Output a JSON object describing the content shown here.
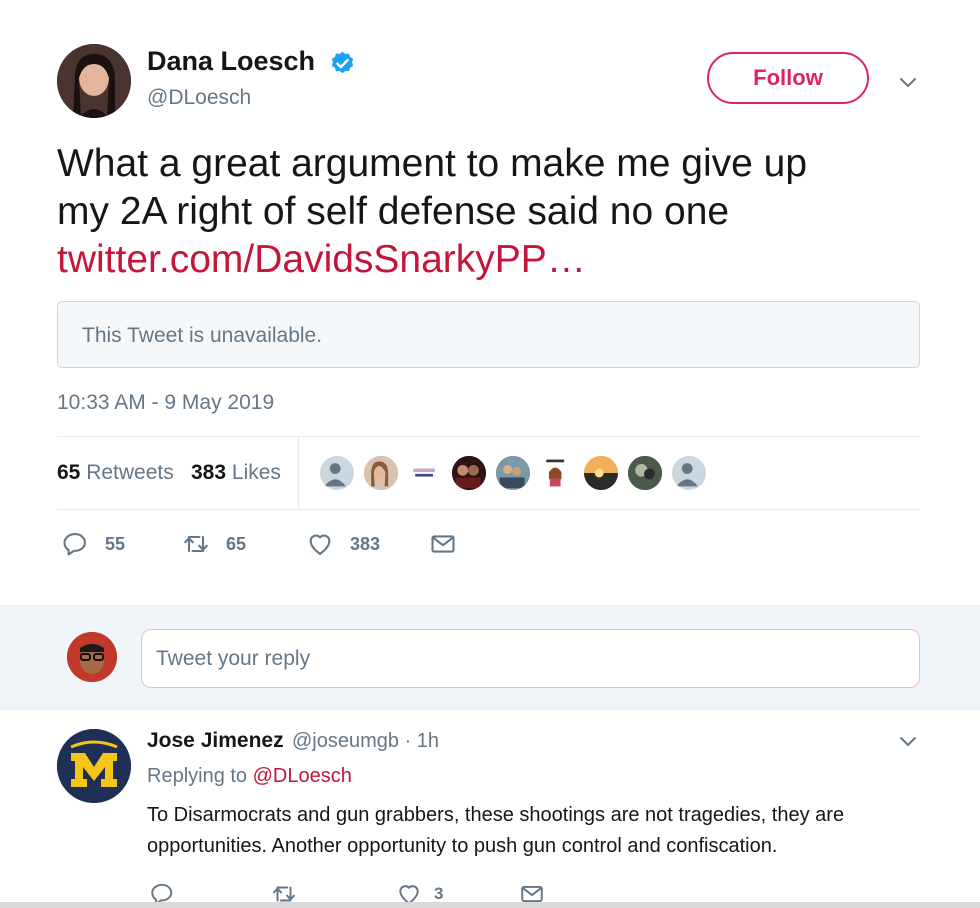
{
  "tweet": {
    "author_name": "Dana Loesch",
    "author_handle": "@DLoesch",
    "follow_label": "Follow",
    "text_line1": "What a great argument to make me give up",
    "text_line2": "my 2A right of self defense said no one",
    "link": "twitter.com/DavidsSnarkyPP…",
    "quote_unavailable": "This Tweet is unavailable.",
    "timestamp": "10:33 AM - 9 May 2019",
    "retweets_count": "65",
    "retweets_label": "Retweets",
    "likes_count": "383",
    "likes_label": "Likes",
    "actions": {
      "reply_count": "55",
      "retweet_count": "65",
      "like_count": "383"
    },
    "colors": {
      "accent": "#e0245e",
      "link": "#c4163a",
      "verified": "#1da1f2",
      "muted": "#657786"
    }
  },
  "reply_box": {
    "placeholder": "Tweet your reply"
  },
  "reply": {
    "name": "Jose Jimenez",
    "handle_time": "@joseumgb · 1h",
    "replying_prefix": "Replying to",
    "replying_to": "@DLoesch",
    "text": "To Disarmocrats and gun grabbers, these shootings are not tragedies, they are opportunities. Another opportunity to push gun control and confiscation.",
    "actions": {
      "like_count": "3"
    }
  }
}
